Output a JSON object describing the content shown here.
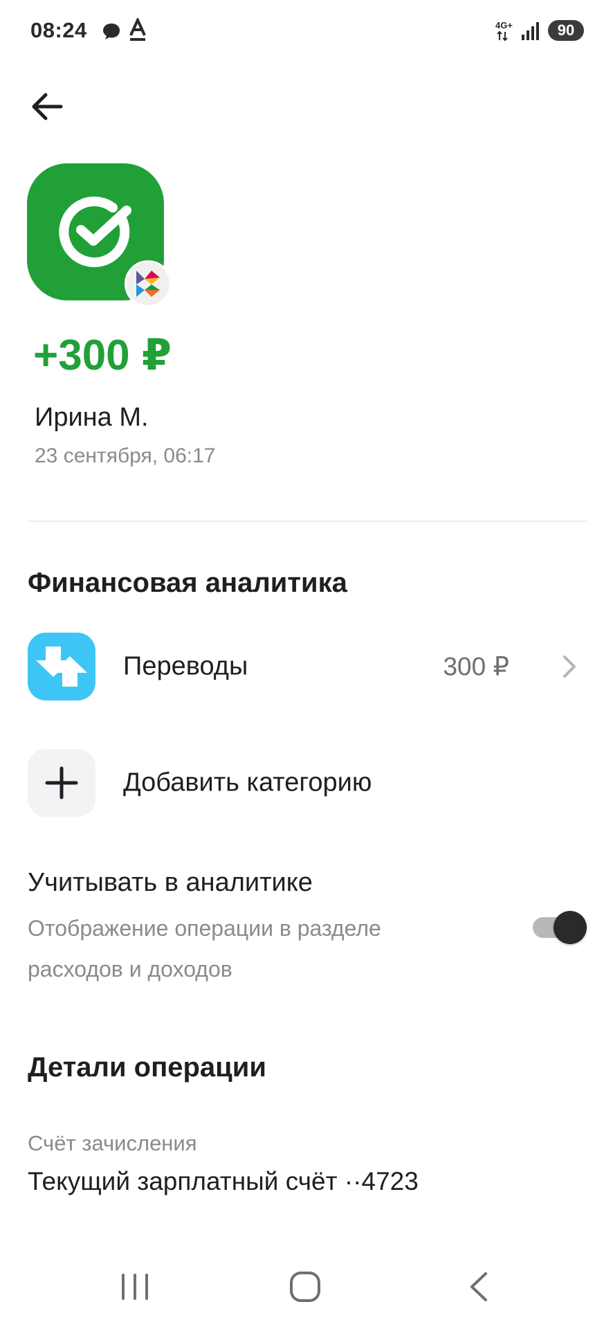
{
  "status_bar": {
    "time": "08:24",
    "network": "4G+",
    "battery": "90"
  },
  "header": {
    "back_icon": "arrow-left-icon"
  },
  "transaction": {
    "logo_icon": "sberbank-logo-icon",
    "badge_icon": "sbp-icon",
    "amount": "+300 ₽",
    "amount_color": "#21a038",
    "sender": "Ирина М.",
    "date": "23 сентября, 06:17"
  },
  "analytics": {
    "title": "Финансовая аналитика",
    "category": {
      "icon": "transfer-arrows-icon",
      "label": "Переводы",
      "value": "300 ₽",
      "color": "#3dc6f5"
    },
    "add_category": {
      "icon": "plus-icon",
      "label": "Добавить категорию"
    },
    "include": {
      "title": "Учитывать в аналитике",
      "description": "Отображение операции в разделе расходов и доходов",
      "enabled": true
    }
  },
  "details": {
    "title": "Детали операции",
    "account_label": "Счёт зачисления",
    "account_value": "Текущий зарплатный счёт ··4723"
  },
  "nav_bar": {
    "recent_icon": "recent-apps-icon",
    "home_icon": "home-icon",
    "back_icon": "back-icon"
  }
}
